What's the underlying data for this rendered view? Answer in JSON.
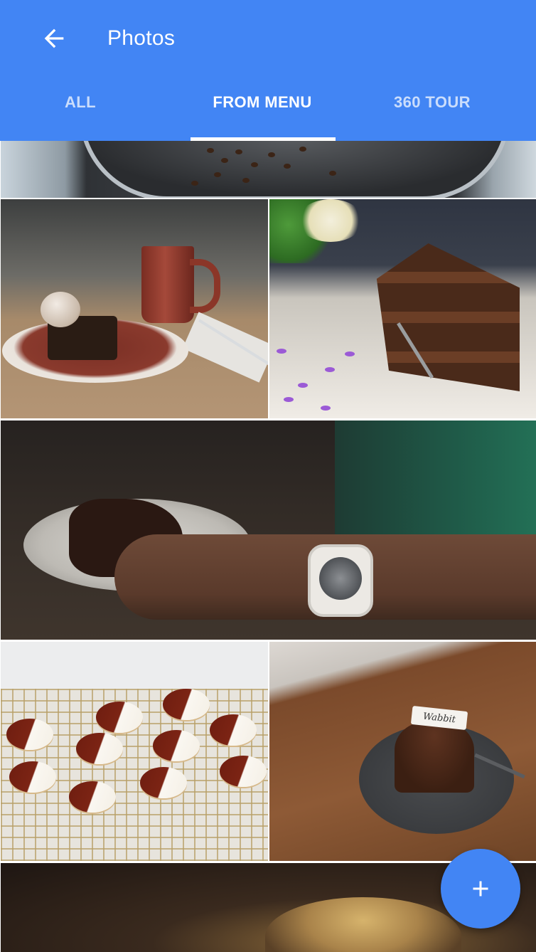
{
  "header": {
    "title": "Photos",
    "back_icon": "arrow-back-icon"
  },
  "tabs": [
    {
      "label": "ALL",
      "active": false
    },
    {
      "label": "FROM MENU",
      "active": true
    },
    {
      "label": "360 TOUR",
      "active": false
    }
  ],
  "photos": [
    {
      "subject": "coffee-roaster"
    },
    {
      "subject": "brownie-with-coffee"
    },
    {
      "subject": "chocolate-layer-cake"
    },
    {
      "subject": "watch-and-cake"
    },
    {
      "subject": "black-and-white-cookies"
    },
    {
      "subject": "chocolate-cupcake",
      "card_text": "Wabbit"
    },
    {
      "subject": "espresso-cup"
    }
  ],
  "fab": {
    "icon": "add-icon"
  },
  "colors": {
    "primary": "#4285f4",
    "on_primary": "#ffffff",
    "inactive_tab": "rgba(255,255,255,0.72)"
  }
}
